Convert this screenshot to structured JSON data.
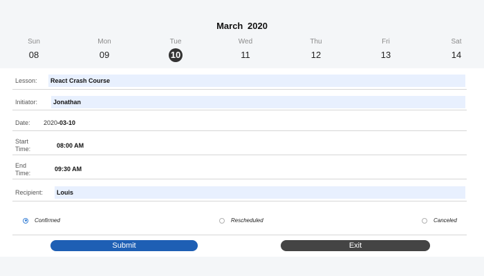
{
  "calendar": {
    "month": "March",
    "year": "2020",
    "days": [
      {
        "name": "Sun",
        "num": "08"
      },
      {
        "name": "Mon",
        "num": "09"
      },
      {
        "name": "Tue",
        "num": "10",
        "selected": true
      },
      {
        "name": "Wed",
        "num": "11"
      },
      {
        "name": "Thu",
        "num": "12"
      },
      {
        "name": "Fri",
        "num": "13"
      },
      {
        "name": "Sat",
        "num": "14"
      }
    ]
  },
  "form": {
    "lesson_label": "Lesson:",
    "lesson_value": "React Crash Course",
    "initiator_label": "Initiator:",
    "initiator_value": "Jonathan",
    "date_label": "Date:",
    "date_year": "2020",
    "date_rest": "-03-10",
    "start_label_1": "Start",
    "start_label_2": "Time:",
    "start_value": "08:00 AM",
    "end_label_1": "End",
    "end_label_2": "Time:",
    "end_value": "09:30 AM",
    "recipient_label": "Recipient:",
    "recipient_value": "Louis"
  },
  "status": {
    "options": [
      "Confirmed",
      "Rescheduled",
      "Canceled"
    ],
    "selected": "Confirmed"
  },
  "buttons": {
    "submit": "Submit",
    "exit": "Exit"
  },
  "colors": {
    "accent": "#1e5fb4",
    "exit": "#444444",
    "field_bg": "#e8f0fe",
    "radio": "#3b82d6"
  }
}
